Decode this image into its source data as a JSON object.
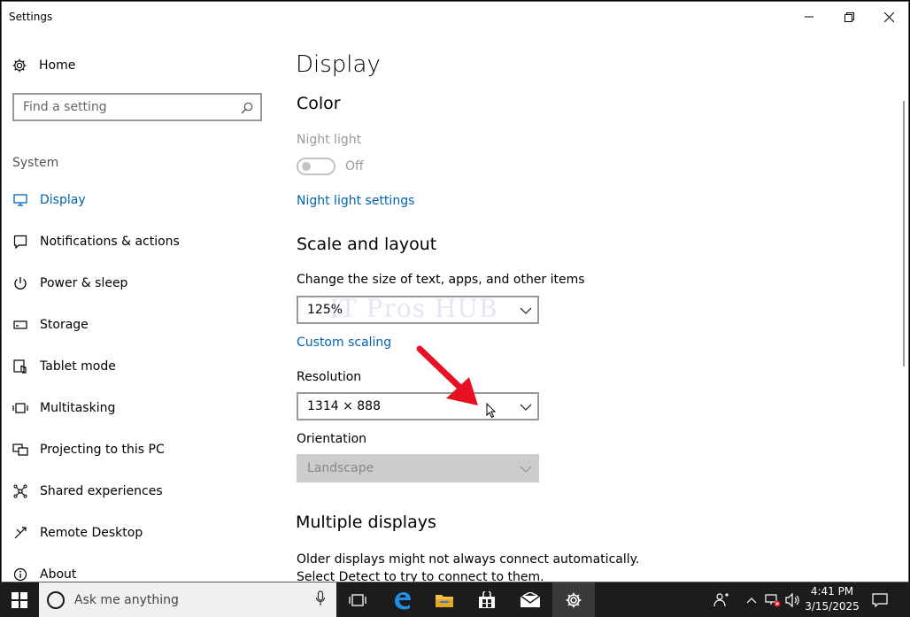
{
  "window": {
    "title": "Settings"
  },
  "sidebar": {
    "home_label": "Home",
    "search_placeholder": "Find a setting",
    "section_label": "System",
    "items": [
      {
        "label": "Display",
        "icon": "monitor-icon",
        "active": true
      },
      {
        "label": "Notifications & actions",
        "icon": "notification-icon"
      },
      {
        "label": "Power & sleep",
        "icon": "power-icon"
      },
      {
        "label": "Storage",
        "icon": "storage-icon"
      },
      {
        "label": "Tablet mode",
        "icon": "tablet-icon"
      },
      {
        "label": "Multitasking",
        "icon": "multitasking-icon"
      },
      {
        "label": "Projecting to this PC",
        "icon": "projecting-icon"
      },
      {
        "label": "Shared experiences",
        "icon": "shared-icon"
      },
      {
        "label": "Remote Desktop",
        "icon": "remote-desktop-icon"
      },
      {
        "label": "About",
        "icon": "info-icon"
      }
    ]
  },
  "main": {
    "title": "Display",
    "color": {
      "heading": "Color",
      "night_light_label": "Night light",
      "night_light_state": "Off",
      "night_light_settings_link": "Night light settings"
    },
    "scale": {
      "heading": "Scale and layout",
      "size_label": "Change the size of text, apps, and other items",
      "size_value": "125%",
      "custom_scaling_link": "Custom scaling",
      "resolution_label": "Resolution",
      "resolution_value": "1314 × 888",
      "orientation_label": "Orientation",
      "orientation_value": "Landscape"
    },
    "multiple": {
      "heading": "Multiple displays",
      "description": "Older displays might not always connect automatically. Select Detect to try to connect to them."
    }
  },
  "watermark": "IT Pros HUB",
  "taskbar": {
    "search_placeholder": "Ask me anything",
    "time": "4:41 PM",
    "date": "3/15/2025"
  },
  "colors": {
    "accent": "#0063b1",
    "arrow": "#e81123",
    "taskbar": "#1c1c1c"
  }
}
